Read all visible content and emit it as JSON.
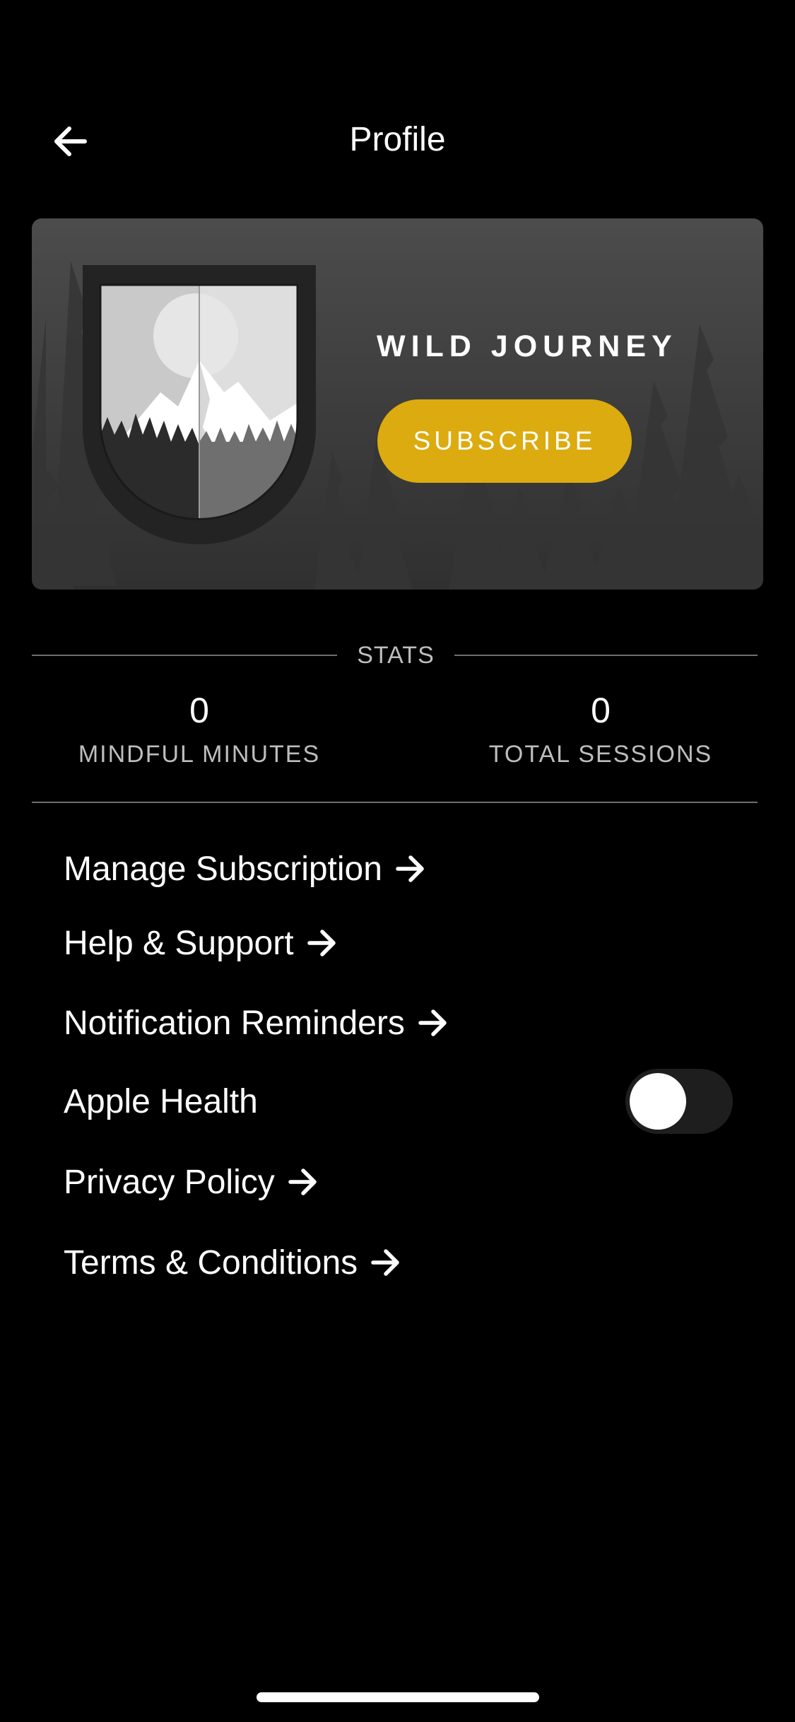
{
  "header": {
    "title": "Profile",
    "back_icon": "arrow-left-icon"
  },
  "hero": {
    "brand_name": "WILD JOURNEY",
    "subscribe_label": "SUBSCRIBE",
    "accent_color": "#dcab0f",
    "badge_icon": "mountain-shield-icon"
  },
  "stats": {
    "title": "STATS",
    "items": [
      {
        "value": "0",
        "label": "MINDFUL MINUTES"
      },
      {
        "value": "0",
        "label": "TOTAL SESSIONS"
      }
    ]
  },
  "menu": {
    "manage_subscription": "Manage Subscription",
    "help_support": "Help & Support",
    "notification_reminders": "Notification Reminders",
    "apple_health": "Apple Health",
    "apple_health_enabled": false,
    "privacy_policy": "Privacy Policy",
    "terms_conditions": "Terms & Conditions",
    "arrow_icon": "arrow-right-icon"
  }
}
